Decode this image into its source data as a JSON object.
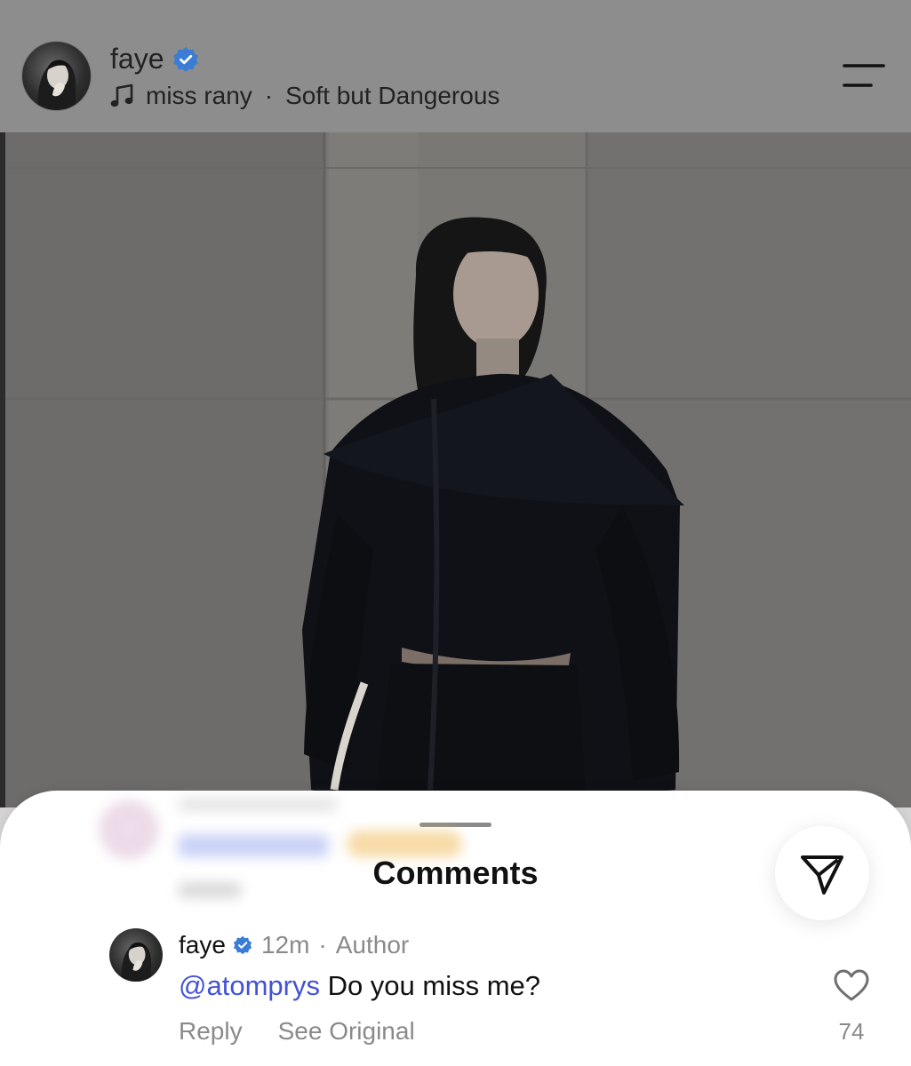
{
  "header": {
    "username": "faye",
    "verified_icon": "verified-badge-icon",
    "music_icon": "music-note-icon",
    "audio_artist": "miss rany",
    "audio_separator": "·",
    "audio_title": "Soft but Dangerous",
    "menu_icon": "menu-icon"
  },
  "post": {
    "media": "photo"
  },
  "comments_sheet": {
    "title": "Comments",
    "send_icon": "send-icon",
    "comment": {
      "author": "faye",
      "time": "12m",
      "separator": "·",
      "role": "Author",
      "mention": "@atomprys",
      "text": " Do you miss me?",
      "reply_label": "Reply",
      "see_original_label": "See Original",
      "like_icon": "heart-icon",
      "like_count": "74"
    }
  },
  "colors": {
    "header_bg": "#8d8d8d",
    "verified_blue": "#3b7cd4",
    "mention_blue": "#4352d6",
    "meta_gray": "#8a8a8a"
  }
}
